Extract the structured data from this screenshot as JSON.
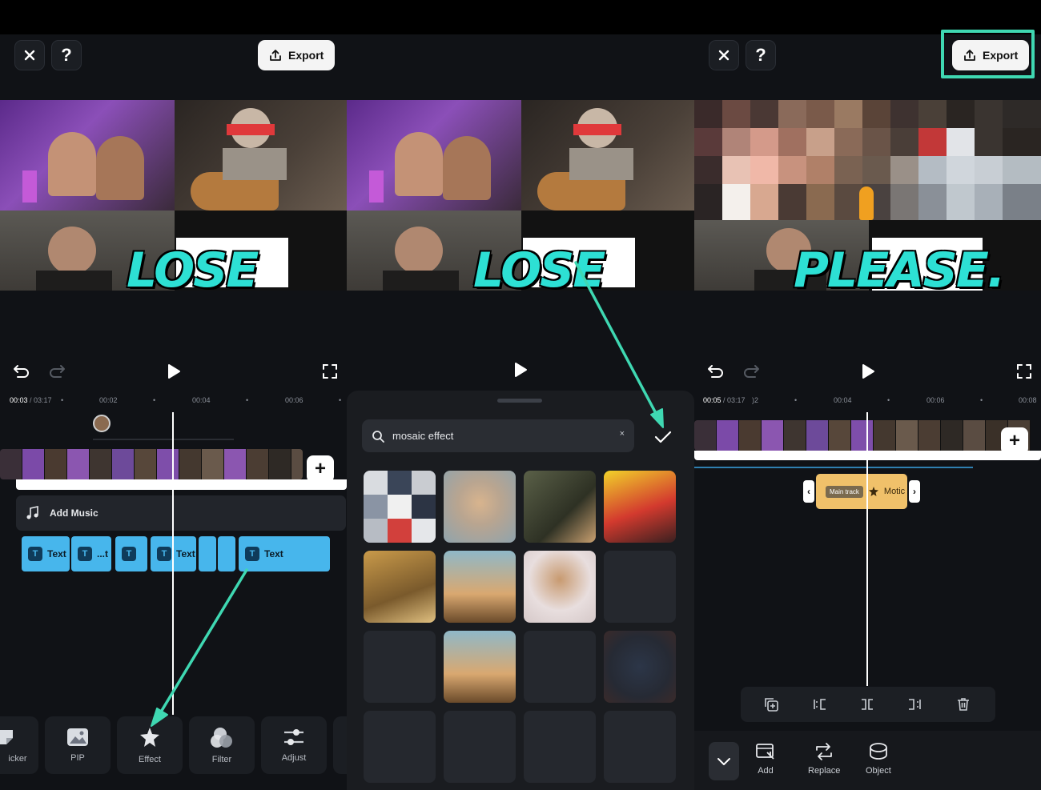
{
  "colors": {
    "accent_teal": "#3fd8b2",
    "caption_cyan": "#2de0d4",
    "text_clip_blue": "#47b6ec",
    "effect_clip_gold": "#f0c16a",
    "panel_bg": "#101216"
  },
  "panel1": {
    "close_icon": "close-icon",
    "help_label": "?",
    "export_label": "Export",
    "caption": "LOSE",
    "time_current": "00:03",
    "time_total": "/ 03:17",
    "ticks": [
      "00:02",
      "00:04",
      "00:06"
    ],
    "add_music_label": "Add Music",
    "text_clips": [
      "Text",
      "...t",
      "",
      "Text",
      "",
      "",
      "Text"
    ],
    "toolbar": [
      {
        "label": "icker",
        "icon": "sticker-icon"
      },
      {
        "label": "PIP",
        "icon": "pip-icon"
      },
      {
        "label": "Effect",
        "icon": "effect-icon"
      },
      {
        "label": "Filter",
        "icon": "filter-icon"
      },
      {
        "label": "Adjust",
        "icon": "adjust-icon"
      }
    ]
  },
  "panel2": {
    "caption": "LOSE",
    "search_value": "mosaic effect",
    "clear_label": "×",
    "confirm_icon": "checkmark-icon"
  },
  "panel3": {
    "help_label": "?",
    "export_label": "Export",
    "caption": "PLEASE.",
    "time_current": "00:05",
    "time_total": "/ 03:17",
    "ticks": [
      "00:04",
      "00:06",
      "00:08"
    ],
    "tick_partial": ")2",
    "main_track_chip": "Main track",
    "effect_clip_label": "Motic",
    "edit_tools": [
      "copy-icon",
      "split-left-icon",
      "split-icon",
      "split-right-icon",
      "delete-icon"
    ],
    "bottom_items": [
      {
        "label": "Add",
        "icon": "add-object-icon"
      },
      {
        "label": "Replace",
        "icon": "replace-icon"
      },
      {
        "label": "Object",
        "icon": "object-icon"
      }
    ]
  }
}
